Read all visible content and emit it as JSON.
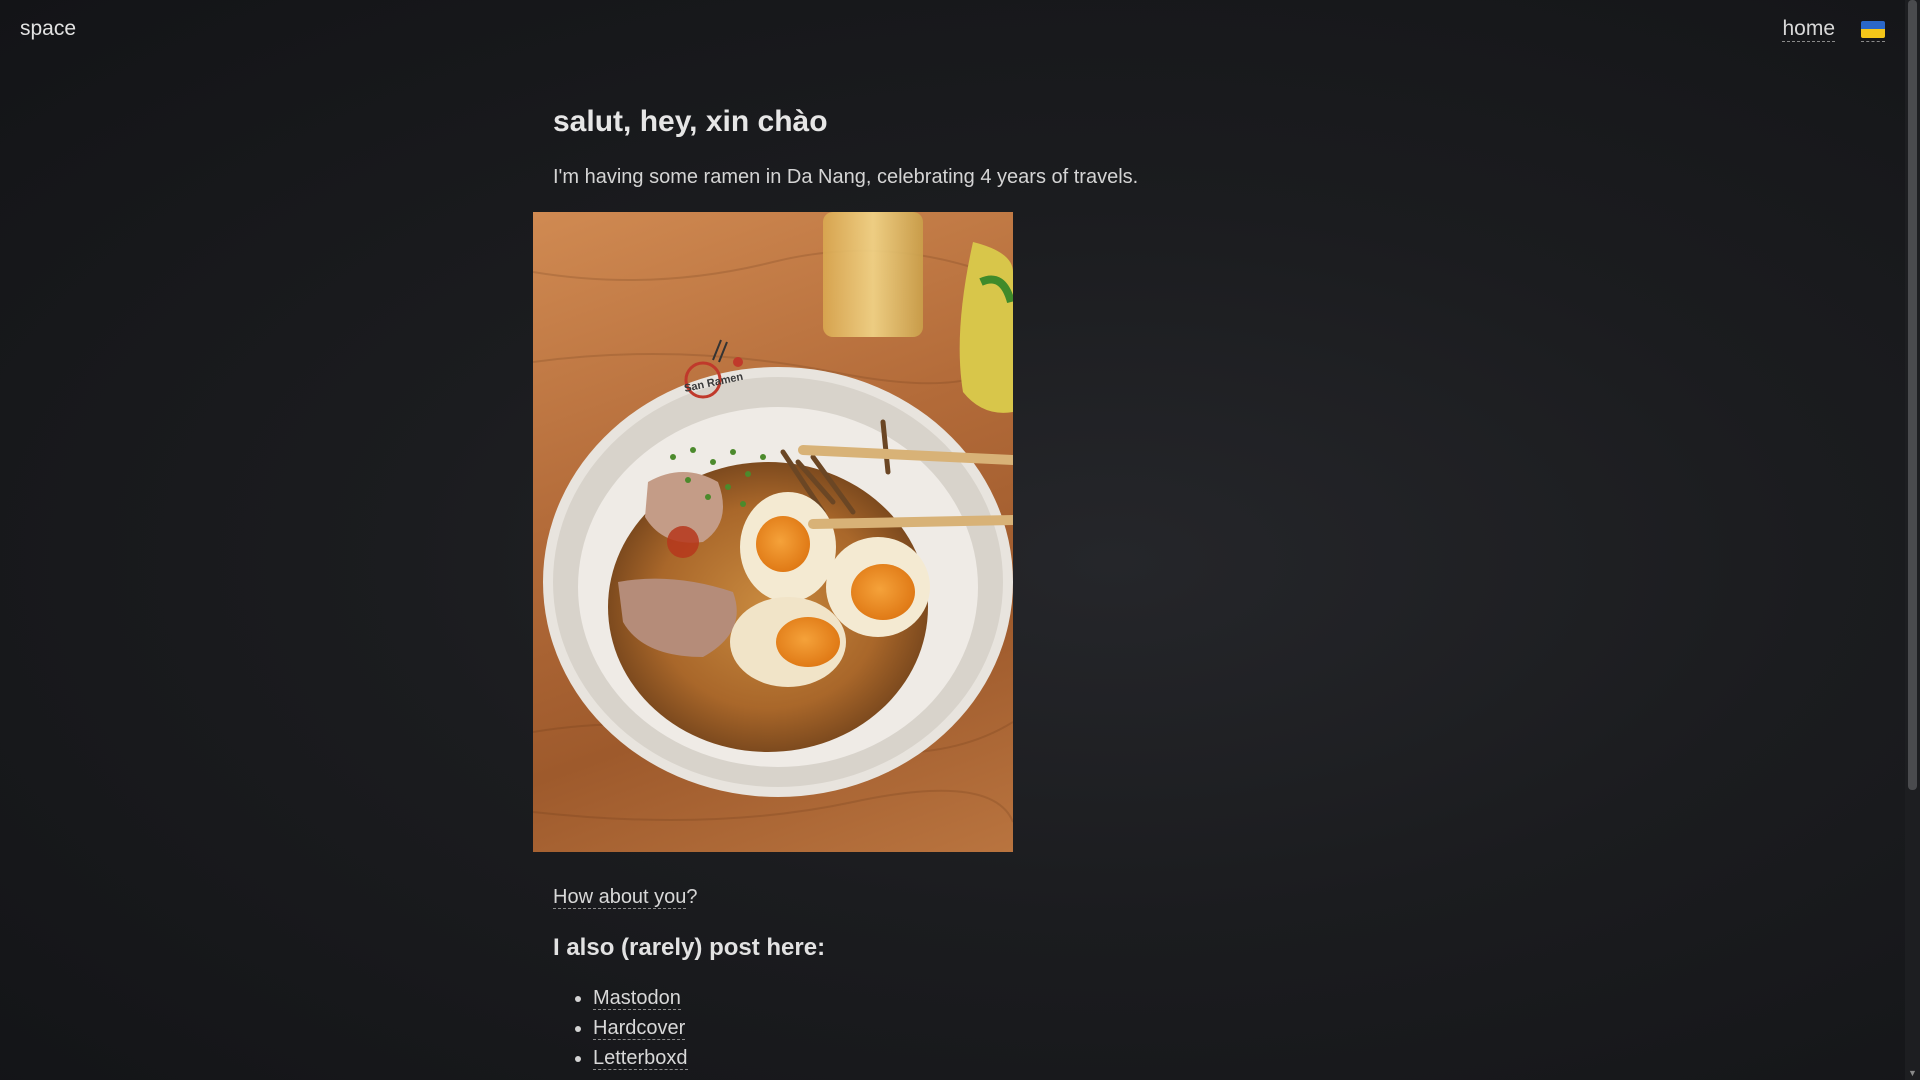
{
  "header": {
    "site_title": "space",
    "nav_home": "home",
    "language_flag": "ukraine-flag-icon"
  },
  "main": {
    "heading": "salut, hey, xin chào",
    "intro": "I'm having some ramen in Da Nang, celebrating 4 years of travels.",
    "photo_label": "ramen-photo",
    "question_link": "How about you",
    "question_suffix": "?",
    "links_heading": "I also (rarely) post here:",
    "links": [
      {
        "label": "Mastodon"
      },
      {
        "label": "Hardcover"
      },
      {
        "label": "Letterboxd"
      }
    ]
  },
  "photo_text": {
    "bowl_logo": "San Ramen"
  },
  "colors": {
    "background": "#1b1c1f",
    "text": "#d6d6d6",
    "flag_blue": "#2a67c9",
    "flag_yellow": "#f4c619"
  }
}
